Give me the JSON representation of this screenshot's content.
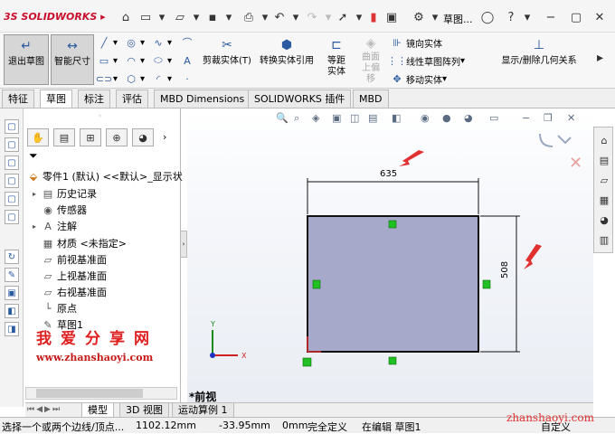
{
  "app": {
    "logo_text": "SOLIDWORKS",
    "title": "草图..."
  },
  "ribbon": {
    "exit_sketch": "退出草图",
    "smart_dim": "智能尺寸",
    "trim": "剪裁实体(T)",
    "convert": "转换实体引用",
    "offset": "等距实体",
    "surface_offset": "曲面上偏移",
    "mirror": "镜向实体",
    "linear_pattern": "线性草图阵列",
    "move": "移动实体",
    "show_hide": "显示/删除几何关系"
  },
  "tabs": [
    "特征",
    "草图",
    "标注",
    "评估",
    "MBD Dimensions",
    "SOLIDWORKS 插件",
    "MBD"
  ],
  "active_tab": "草图",
  "tree": {
    "root": "零件1 (默认) <<默认>_显示状",
    "items": [
      "历史记录",
      "传感器",
      "注解",
      "材质 <未指定>",
      "前视基准面",
      "上视基准面",
      "右视基准面",
      "原点",
      "草图1"
    ]
  },
  "watermark": {
    "cn": "我爱分享网",
    "url": "www.zhanshaoyi.com",
    "url2": "zhanshaoyi.com"
  },
  "sketch": {
    "width_dim": "635",
    "height_dim": "508",
    "view_name": "*前视"
  },
  "bottom_tabs": [
    "模型",
    "3D 视图",
    "运动算例 1"
  ],
  "status": {
    "hint": "选择一个或两个边线/顶点...",
    "x": "1102.12mm",
    "y": "-33.95mm",
    "z": "0mm",
    "state": "完全定义",
    "editing": "在编辑 草图1",
    "custom": "自定义"
  },
  "colors": {
    "rect_fill": "#a7a9cb",
    "dim_arrow": "#e03030",
    "handle": "#22c022"
  }
}
